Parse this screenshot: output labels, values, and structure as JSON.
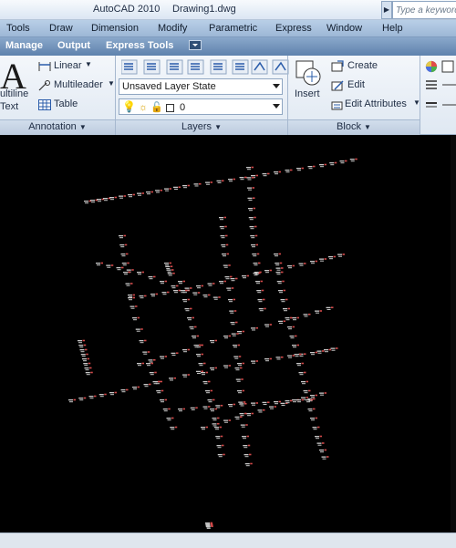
{
  "titlebar": {
    "app_name": "AutoCAD 2010",
    "document": "Drawing1.dwg",
    "search_placeholder": "Type a keyword"
  },
  "menu": [
    "Tools",
    "Draw",
    "Dimension",
    "Modify",
    "Parametric",
    "Express",
    "Window",
    "Help"
  ],
  "ribbon_tabs": [
    "Manage",
    "Output",
    "Express Tools"
  ],
  "annotation": {
    "multiline_text_line1": "ultiline",
    "multiline_text_line2": "Text",
    "linear": "Linear",
    "multileader": "Multileader",
    "table": "Table",
    "footer": "Annotation"
  },
  "layers": {
    "layer_state": "Unsaved Layer State",
    "current_layer": "0",
    "footer": "Layers"
  },
  "block": {
    "insert": "Insert",
    "create": "Create",
    "edit": "Edit",
    "edit_attributes": "Edit Attributes",
    "footer": "Block"
  },
  "colors": {
    "ribbon_tab_bg": "#6e8fb6",
    "menu_bg": "#a5bedb",
    "canvas_bg": "#000000",
    "drawing_text": "#c8c8c8",
    "drawing_accent": "#d24a4a"
  }
}
